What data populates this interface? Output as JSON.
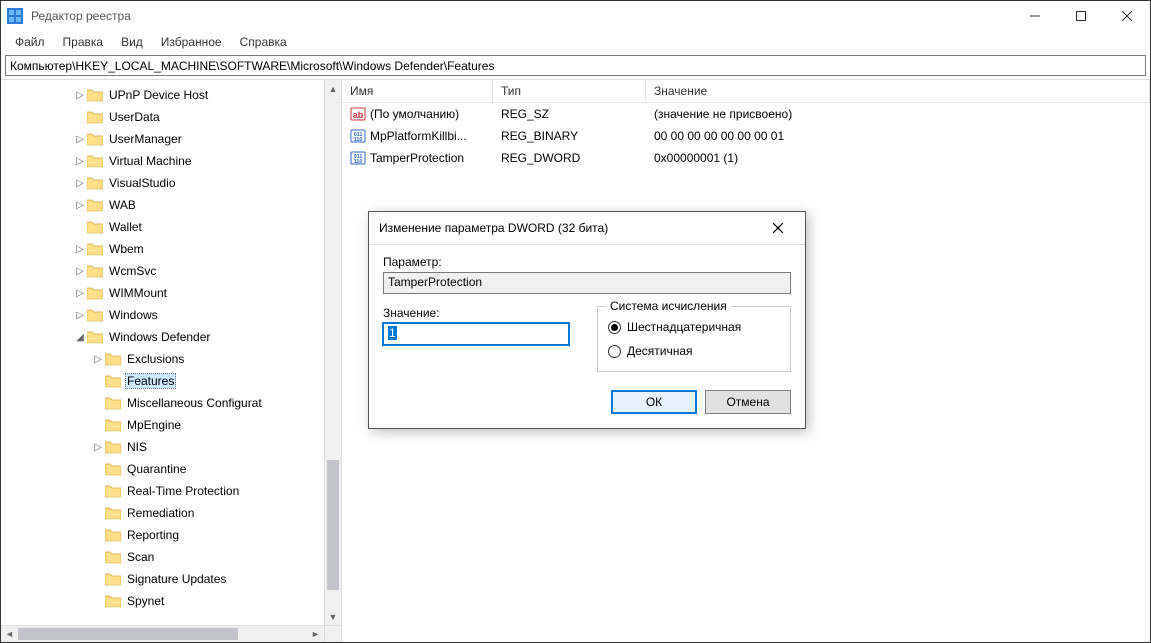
{
  "window": {
    "title": "Редактор реестра"
  },
  "menu": {
    "file": "Файл",
    "edit": "Правка",
    "view": "Вид",
    "favorites": "Избранное",
    "help": "Справка"
  },
  "address": "Компьютер\\HKEY_LOCAL_MACHINE\\SOFTWARE\\Microsoft\\Windows Defender\\Features",
  "tree": [
    {
      "indent": 4,
      "chev": "closed",
      "label": "UPnP Device Host"
    },
    {
      "indent": 4,
      "chev": "none",
      "label": "UserData"
    },
    {
      "indent": 4,
      "chev": "closed",
      "label": "UserManager"
    },
    {
      "indent": 4,
      "chev": "closed",
      "label": "Virtual Machine"
    },
    {
      "indent": 4,
      "chev": "closed",
      "label": "VisualStudio"
    },
    {
      "indent": 4,
      "chev": "closed",
      "label": "WAB"
    },
    {
      "indent": 4,
      "chev": "none",
      "label": "Wallet"
    },
    {
      "indent": 4,
      "chev": "closed",
      "label": "Wbem"
    },
    {
      "indent": 4,
      "chev": "closed",
      "label": "WcmSvc"
    },
    {
      "indent": 4,
      "chev": "closed",
      "label": "WIMMount"
    },
    {
      "indent": 4,
      "chev": "closed",
      "label": "Windows"
    },
    {
      "indent": 4,
      "chev": "open",
      "label": "Windows Defender"
    },
    {
      "indent": 5,
      "chev": "closed",
      "label": "Exclusions"
    },
    {
      "indent": 5,
      "chev": "none",
      "label": "Features",
      "selected": true
    },
    {
      "indent": 5,
      "chev": "none",
      "label": "Miscellaneous Configurat"
    },
    {
      "indent": 5,
      "chev": "none",
      "label": "MpEngine"
    },
    {
      "indent": 5,
      "chev": "closed",
      "label": "NIS"
    },
    {
      "indent": 5,
      "chev": "none",
      "label": "Quarantine"
    },
    {
      "indent": 5,
      "chev": "none",
      "label": "Real-Time Protection"
    },
    {
      "indent": 5,
      "chev": "none",
      "label": "Remediation"
    },
    {
      "indent": 5,
      "chev": "none",
      "label": "Reporting"
    },
    {
      "indent": 5,
      "chev": "none",
      "label": "Scan"
    },
    {
      "indent": 5,
      "chev": "none",
      "label": "Signature Updates"
    },
    {
      "indent": 5,
      "chev": "none",
      "label": "Spynet"
    }
  ],
  "columns": {
    "name": "Имя",
    "type": "Тип",
    "value": "Значение"
  },
  "values": [
    {
      "icon": "string",
      "name": "(По умолчанию)",
      "type": "REG_SZ",
      "value": "(значение не присвоено)"
    },
    {
      "icon": "binary",
      "name": "MpPlatformKillbi...",
      "type": "REG_BINARY",
      "value": "00 00 00 00 00 00 00 01"
    },
    {
      "icon": "binary",
      "name": "TamperProtection",
      "type": "REG_DWORD",
      "value": "0x00000001 (1)"
    }
  ],
  "dialog": {
    "title": "Изменение параметра DWORD (32 бита)",
    "param_label": "Параметр:",
    "param_value": "TamperProtection",
    "value_label": "Значение:",
    "value_value": "1",
    "base_legend": "Система исчисления",
    "radio_hex": "Шестнадцатеричная",
    "radio_dec": "Десятичная",
    "ok": "ОК",
    "cancel": "Отмена"
  }
}
